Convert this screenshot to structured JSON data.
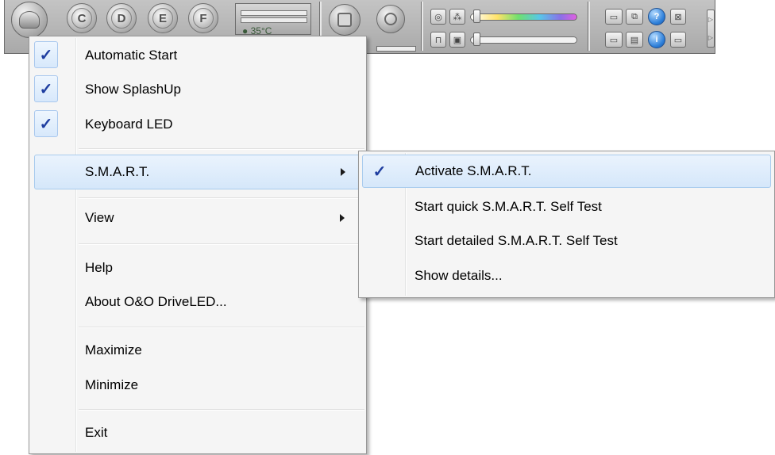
{
  "toolbar": {
    "drives": [
      "C",
      "D",
      "E",
      "F"
    ],
    "temperature": "35°C"
  },
  "main_menu": {
    "items": [
      {
        "id": "automatic-start",
        "label": "Automatic Start",
        "checked": true
      },
      {
        "id": "show-splashup",
        "label": "Show SplashUp",
        "checked": true
      },
      {
        "id": "keyboard-led",
        "label": "Keyboard LED",
        "checked": true
      },
      {
        "id": "smart",
        "label": "S.M.A.R.T.",
        "submenu": true,
        "highlighted": true
      },
      {
        "id": "view",
        "label": "View",
        "submenu": true
      },
      {
        "id": "help",
        "label": "Help"
      },
      {
        "id": "about",
        "label": "About O&O DriveLED..."
      },
      {
        "id": "maximize",
        "label": "Maximize"
      },
      {
        "id": "minimize",
        "label": "Minimize"
      },
      {
        "id": "exit",
        "label": "Exit"
      }
    ]
  },
  "smart_submenu": {
    "items": [
      {
        "id": "activate-smart",
        "label": "Activate S.M.A.R.T.",
        "checked": true,
        "highlighted": true
      },
      {
        "id": "quick-self-test",
        "label": "Start quick S.M.A.R.T. Self Test"
      },
      {
        "id": "detailed-self-test",
        "label": "Start detailed S.M.A.R.T. Self Test"
      },
      {
        "id": "show-details",
        "label": "Show details..."
      }
    ]
  },
  "colors": {
    "check_mark": "#1f3ea0",
    "highlight_border": "#a8cbee",
    "menu_background": "#f5f5f5"
  }
}
